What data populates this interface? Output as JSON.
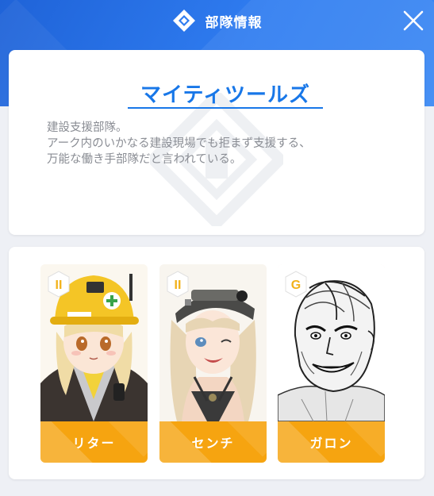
{
  "header": {
    "title": "部隊情報",
    "logo_icon": "squad-diamond-icon",
    "close_icon": "close-icon"
  },
  "unit": {
    "name": "マイティツールズ",
    "description_lines": [
      "建設支援部隊。",
      "アーク内のいかなる建設現場でも拒まず支援する、",
      "万能な働き手部隊だと言われている。"
    ]
  },
  "members": [
    {
      "name": "リター",
      "rank": "II"
    },
    {
      "name": "センチ",
      "rank": "II"
    },
    {
      "name": "ガロン",
      "rank": "G"
    }
  ],
  "colors": {
    "header_blue": "#2f7cf0",
    "accent_blue": "#1877e8",
    "name_plate_orange": "#f6a410",
    "badge_gold": "#f2b21a"
  }
}
